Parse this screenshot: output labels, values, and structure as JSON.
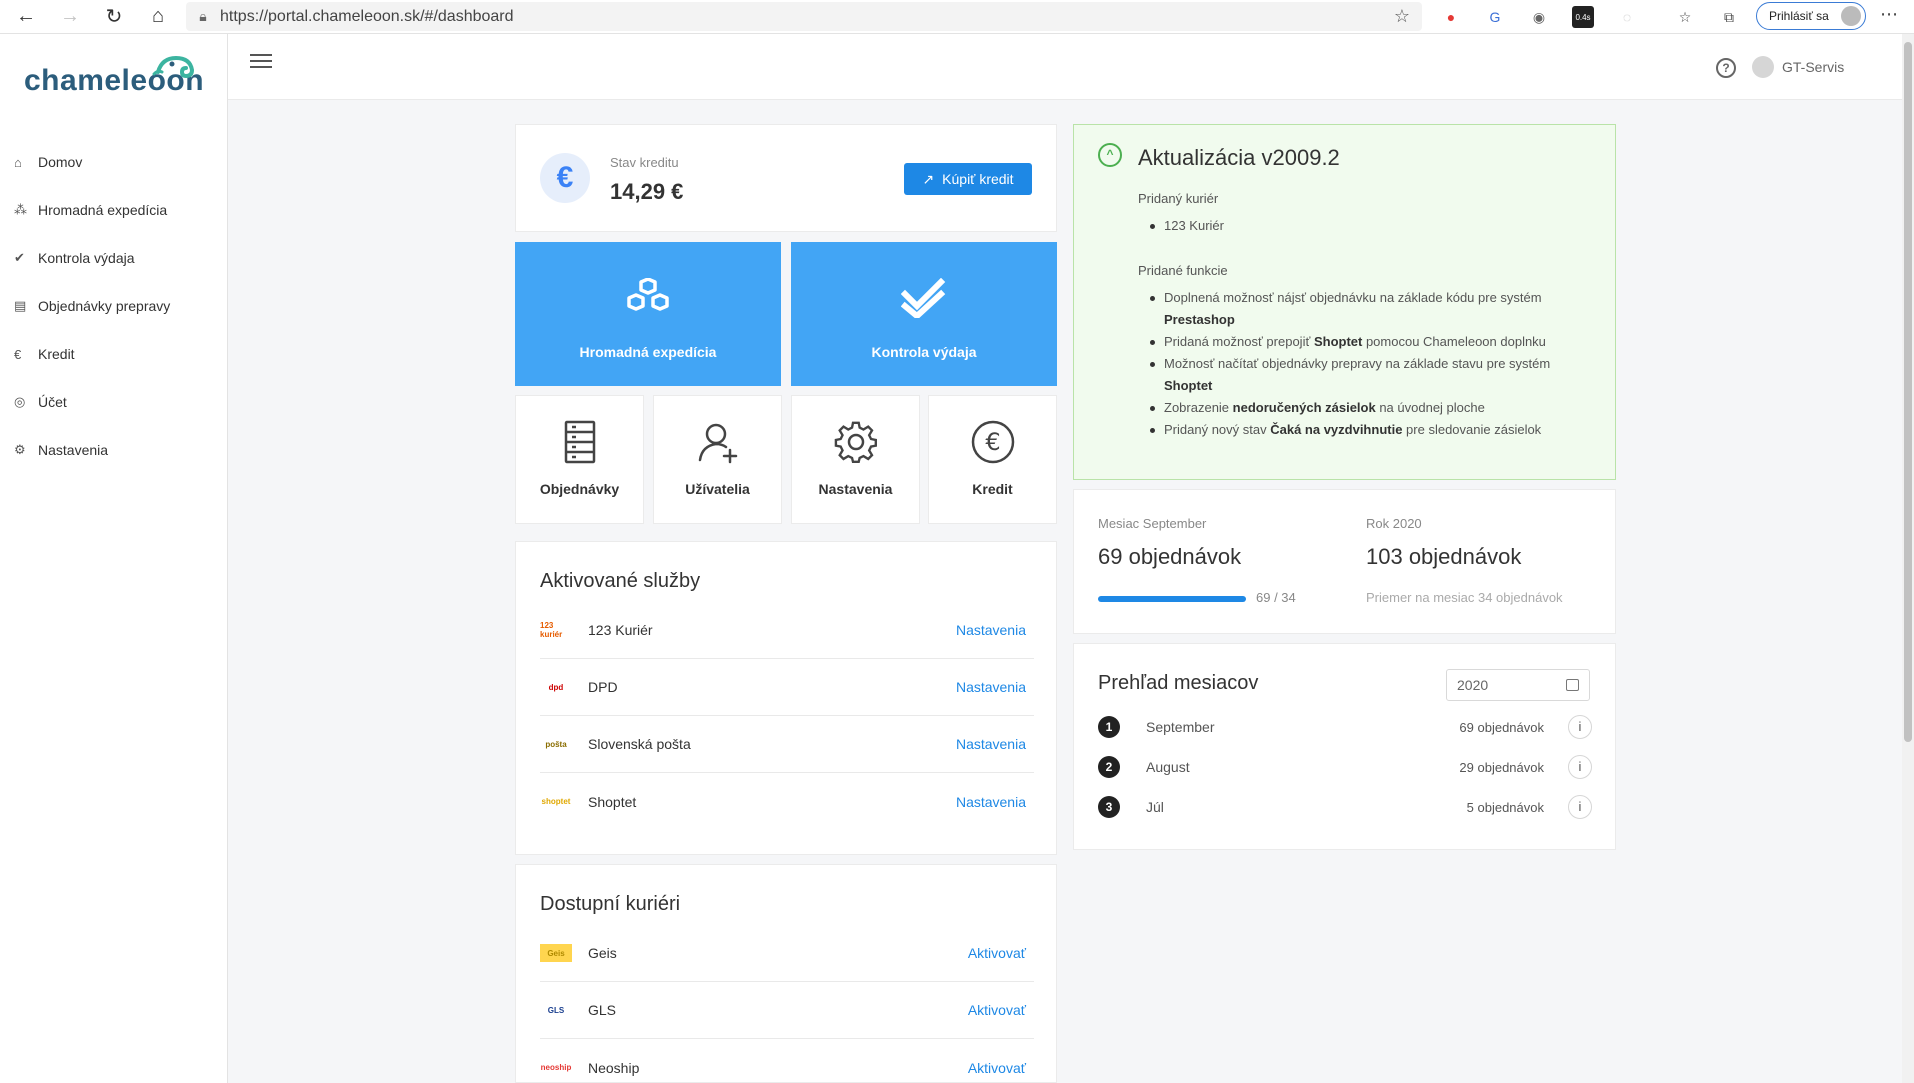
{
  "browser": {
    "url": "https://portal.chameleoon.sk/#/dashboard",
    "login_label": "Prihlásiť sa",
    "ext_badge": "0.4s"
  },
  "sidebar": {
    "logo": "chameleoon",
    "items": [
      {
        "label": "Domov",
        "icon": "home-icon"
      },
      {
        "label": "Hromadná expedícia",
        "icon": "boxes-icon"
      },
      {
        "label": "Kontrola výdaja",
        "icon": "double-check-icon"
      },
      {
        "label": "Objednávky prepravy",
        "icon": "document-icon"
      },
      {
        "label": "Kredit",
        "icon": "euro-icon"
      },
      {
        "label": "Účet",
        "icon": "user-icon"
      },
      {
        "label": "Nastavenia",
        "icon": "gear-icon"
      }
    ]
  },
  "header": {
    "user": "GT-Servis"
  },
  "credit": {
    "label": "Stav kreditu",
    "value": "14,29 €",
    "buy_label": "Kúpiť kredit",
    "icon": "€"
  },
  "tiles": {
    "bulk": "Hromadná expedícia",
    "check": "Kontrola výdaja",
    "orders": "Objednávky",
    "users": "Užívatelia",
    "settings": "Nastavenia",
    "credit": "Kredit"
  },
  "active_services": {
    "title": "Aktivované služby",
    "items": [
      {
        "name": "123 Kuriér",
        "action": "Nastavenia",
        "logo": "123 kuriér"
      },
      {
        "name": "DPD",
        "action": "Nastavenia",
        "logo": "dpd"
      },
      {
        "name": "Slovenská pošta",
        "action": "Nastavenia",
        "logo": "pošta"
      },
      {
        "name": "Shoptet",
        "action": "Nastavenia",
        "logo": "shoptet"
      }
    ]
  },
  "available_couriers": {
    "title": "Dostupní kuriéri",
    "items": [
      {
        "name": "Geis",
        "action": "Aktivovať",
        "logo": "Geis"
      },
      {
        "name": "GLS",
        "action": "Aktivovať",
        "logo": "GLS"
      },
      {
        "name": "Neoship",
        "action": "Aktivovať",
        "logo": "neoship"
      }
    ]
  },
  "update": {
    "title": "Aktualizácia v2009.2",
    "sec1": "Pridaný kuriér",
    "courier": "123 Kuriér",
    "sec2": "Pridané funkcie",
    "f1_text": "Doplnená možnosť nájsť objednávku na základe kódu pre systém ",
    "f1_bold": "Prestashop",
    "f2_a": "Pridaná možnosť prepojiť ",
    "f2_bold": "Shoptet",
    "f2_b": " pomocou Chameleoon doplnku",
    "f3_text": "Možnosť načítať objednávky prepravy na základe stavu pre systém ",
    "f3_bold": "Shoptet",
    "f4_a": "Zobrazenie ",
    "f4_bold": "nedoručených zásielok",
    "f4_b": " na úvodnej ploche",
    "f5_a": "Pridaný nový stav ",
    "f5_bold": "Čaká na vyzdvihnutie",
    "f5_b": " pre sledovanie zásielok"
  },
  "stats": {
    "month_label": "Mesiac September",
    "month_value": "69 objednávok",
    "year_label": "Rok 2020",
    "year_value": "103 objednávok",
    "progress_text": "69 / 34",
    "progress_fraction": 1.0,
    "avg_text": "Priemer na mesiac 34 objednávok"
  },
  "months": {
    "title": "Prehľad mesiacov",
    "year": "2020",
    "rows": [
      {
        "num": "1",
        "name": "September",
        "count": "69 objednávok"
      },
      {
        "num": "2",
        "name": "August",
        "count": "29 objednávok"
      },
      {
        "num": "3",
        "name": "Júl",
        "count": "5 objednávok"
      }
    ]
  },
  "colors": {
    "accent": "#1e88e5",
    "tile_blue": "#42a5f5",
    "update_bg": "#f1fbee",
    "update_border": "#b9e3a8"
  }
}
